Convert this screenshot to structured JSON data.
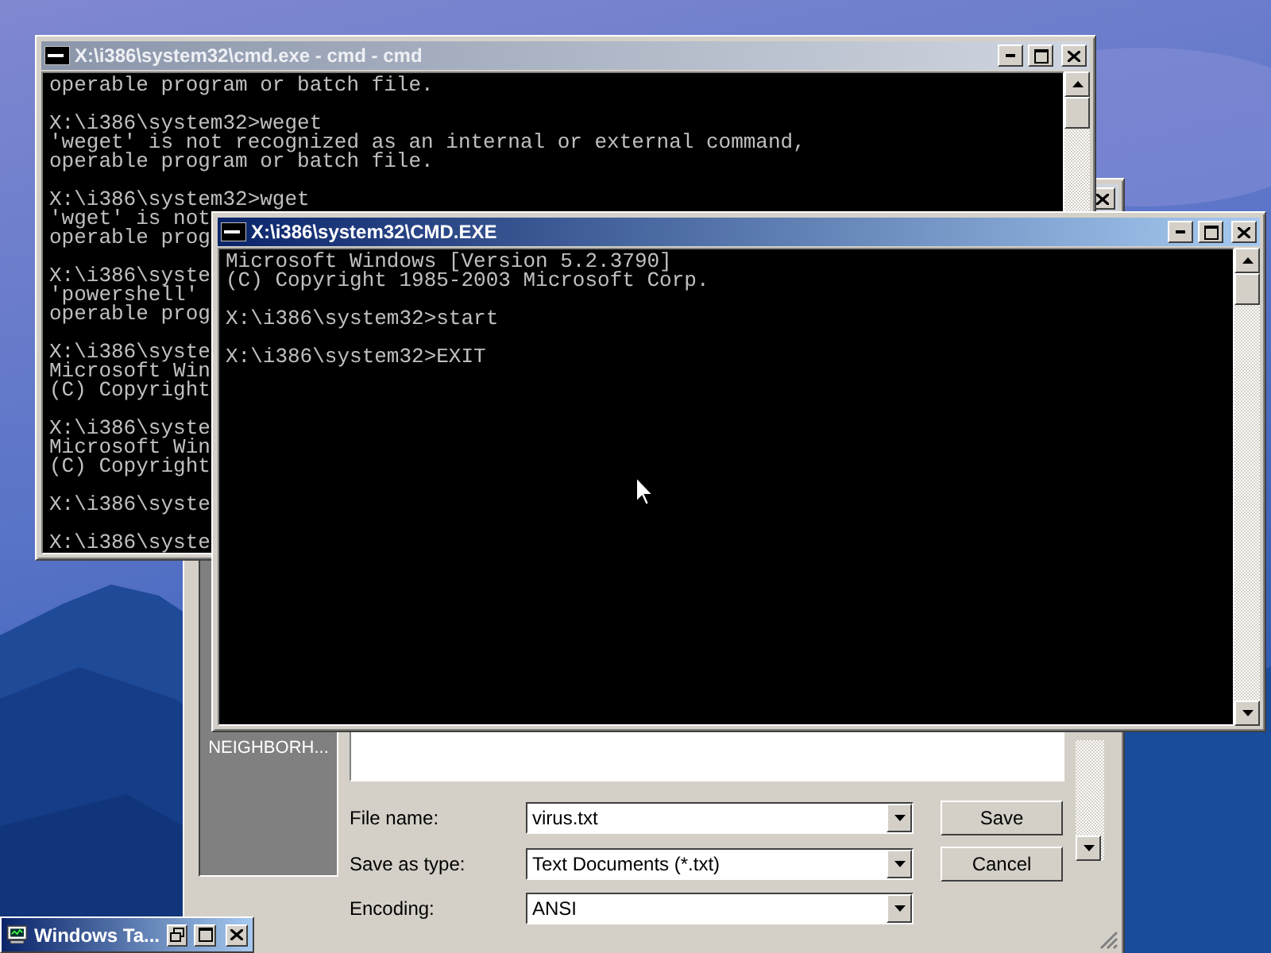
{
  "back_console": {
    "title": "X:\\i386\\system32\\cmd.exe - cmd - cmd",
    "active": false,
    "blocks": [
      [
        "operable program or batch file."
      ],
      [
        "X:\\i386\\system32>weget",
        "'weget' is not recognized as an internal or external command,",
        "operable program or batch file."
      ],
      [
        "X:\\i386\\system32>wget",
        "'wget' is not",
        "operable prog"
      ],
      [
        "X:\\i386\\syste",
        "'powershell'",
        "operable prog"
      ],
      [
        "X:\\i386\\syste",
        "Microsoft Win",
        "(C) Copyright"
      ],
      [
        "X:\\i386\\syste",
        "Microsoft Win",
        "(C) Copyright"
      ],
      [
        "X:\\i386\\syste"
      ],
      [
        "X:\\i386\\syste"
      ]
    ]
  },
  "save_dialog": {
    "active": false,
    "place_bar_label": "NEIGHBORH...",
    "fields": [
      {
        "label": "File name:",
        "value": "virus.txt"
      },
      {
        "label": "Save as type:",
        "value": "Text Documents (*.txt)"
      },
      {
        "label": "Encoding:",
        "value": "ANSI"
      }
    ],
    "buttons": [
      "Save",
      "Cancel"
    ]
  },
  "front_console": {
    "title": "X:\\i386\\system32\\CMD.EXE",
    "active": true,
    "blocks": [
      [
        "Microsoft Windows [Version 5.2.3790]",
        "(C) Copyright 1985-2003 Microsoft Corp."
      ],
      [
        "X:\\i386\\system32>start"
      ],
      [
        "X:\\i386\\system32>EXIT"
      ]
    ]
  },
  "minimized_window": {
    "title": "Windows Ta..."
  }
}
